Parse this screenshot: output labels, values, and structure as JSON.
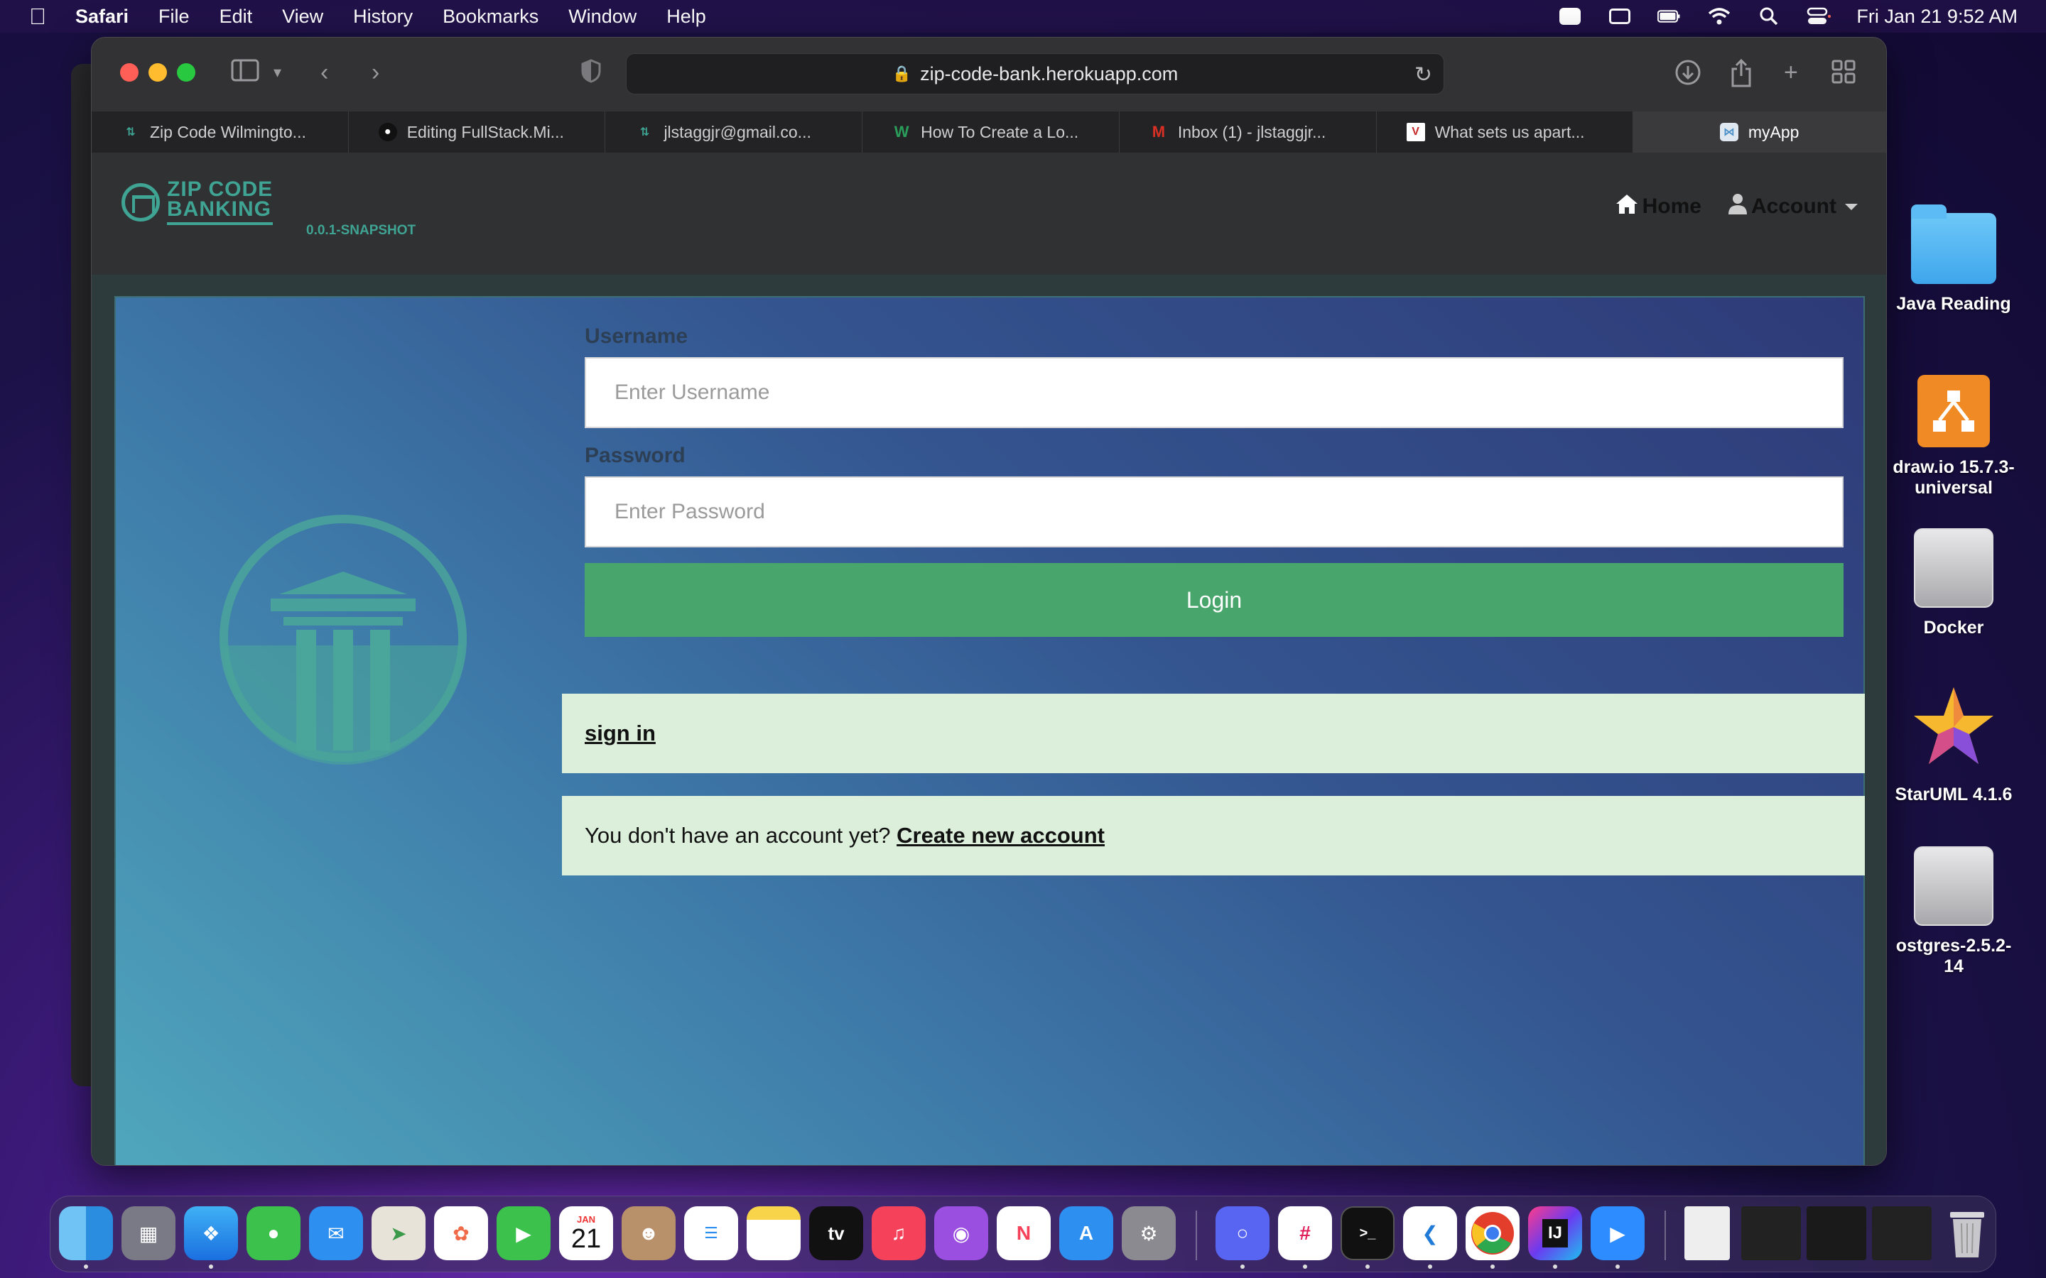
{
  "menubar": {
    "app_name": "Safari",
    "items": [
      "File",
      "Edit",
      "View",
      "History",
      "Bookmarks",
      "Window",
      "Help"
    ],
    "clock": "Fri Jan 21  9:52 AM"
  },
  "browser": {
    "url": "zip-code-bank.herokuapp.com",
    "tabs": [
      {
        "label": "Zip Code Wilmingto...",
        "icon": "zipcode-favicon",
        "color": "#2f8f6f"
      },
      {
        "label": "Editing FullStack.Mi...",
        "icon": "github-favicon",
        "color": "#111111"
      },
      {
        "label": "jlstaggjr@gmail.co...",
        "icon": "zipcode-favicon",
        "color": "#2f8f6f"
      },
      {
        "label": "How To Create a Lo...",
        "icon": "w-favicon",
        "color": "#2a9d5a"
      },
      {
        "label": "Inbox (1) - jlstaggjr...",
        "icon": "gmail-favicon",
        "color": "#d93025"
      },
      {
        "label": "What sets us apart...",
        "icon": "v-favicon",
        "color": "#c62828"
      },
      {
        "label": "myApp",
        "icon": "myapp-favicon",
        "color": "#4a90c8"
      }
    ]
  },
  "app": {
    "logo_line1": "ZIP CODE",
    "logo_line2": "BANKING",
    "version": "0.0.1-SNAPSHOT",
    "nav_home": "Home",
    "nav_account": "Account",
    "username_label": "Username",
    "username_placeholder": "Enter Username",
    "password_label": "Password",
    "password_placeholder": "Enter Password",
    "login_button": "Login",
    "sign_in_link": "sign in",
    "no_account_text": "You don't have an account yet? ",
    "create_account_link": "Create new account"
  },
  "desktop": {
    "items": [
      "Java Reading",
      "draw.io 15.7.3-universal",
      "Docker",
      "StarUML 4.1.6",
      "ostgres-2.5.2-14"
    ]
  },
  "dock": {
    "calendar_month": "JAN",
    "calendar_day": "21",
    "tv_label": "tv"
  },
  "colors": {
    "accent_teal": "#3fa494",
    "login_green": "#48a56b",
    "alert_bg": "#dcefdb"
  }
}
